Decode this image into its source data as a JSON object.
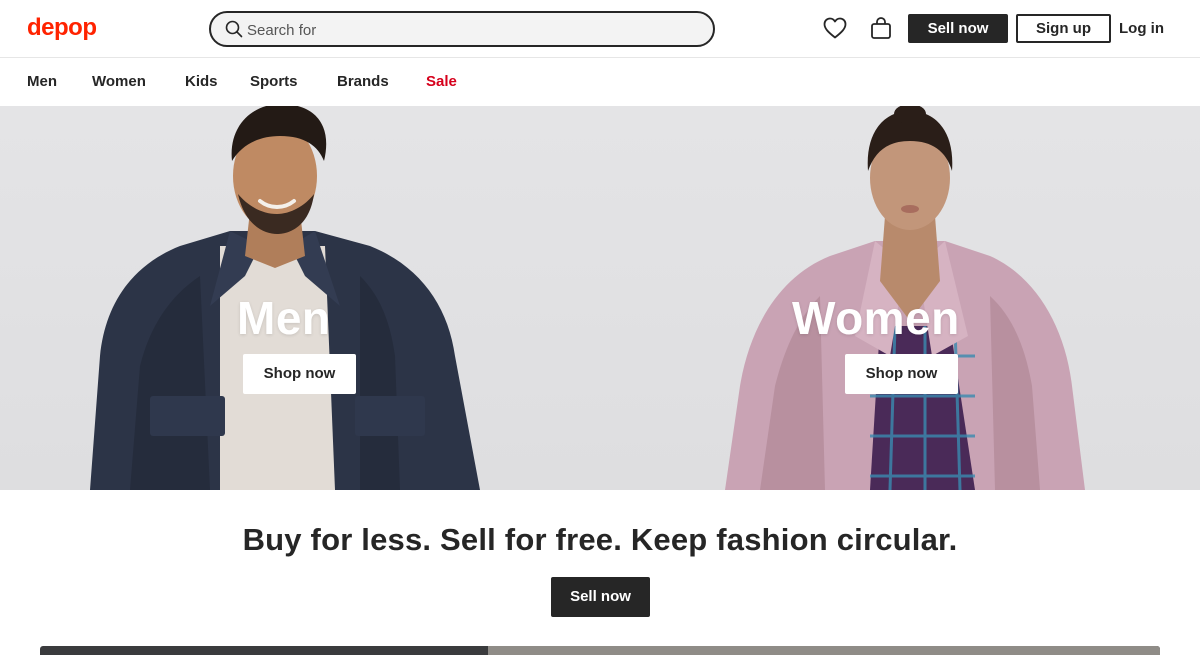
{
  "header": {
    "logo": "depop",
    "search": {
      "placeholder": "Search for",
      "value": ""
    },
    "icons": {
      "wishlist": "heart-icon",
      "bag": "bag-icon",
      "search": "search-icon"
    },
    "sell_label": "Sell now",
    "signup_label": "Sign up",
    "login_label": "Log in"
  },
  "nav": {
    "items": [
      {
        "label": "Men"
      },
      {
        "label": "Women"
      },
      {
        "label": "Kids"
      },
      {
        "label": "Sports"
      },
      {
        "label": "Brands"
      },
      {
        "label": "Sale"
      }
    ]
  },
  "hero": {
    "men": {
      "title": "Men",
      "button": "Shop now"
    },
    "women": {
      "title": "Women",
      "button": "Shop now"
    }
  },
  "promo": {
    "tagline": "Buy for less. Sell for free. Keep fashion circular.",
    "button": "Sell now"
  },
  "colors": {
    "brand": "#ff2300",
    "sale": "#d6001c",
    "dark": "#262626"
  }
}
